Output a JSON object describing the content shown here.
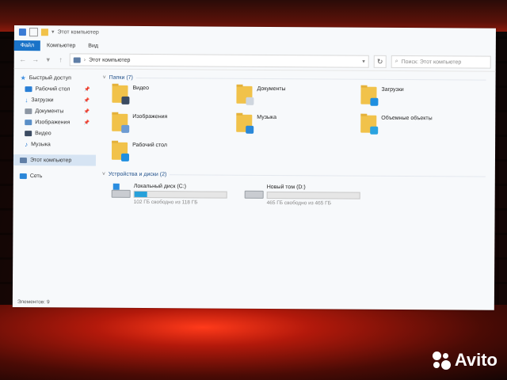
{
  "window": {
    "title": "Этот компьютер",
    "ribbon_tabs": [
      "Файл",
      "Компьютер",
      "Вид"
    ],
    "address": "Этот компьютер",
    "search_placeholder": "Поиск: Этот компьютер"
  },
  "sidebar": {
    "items": [
      {
        "label": "Быстрый доступ",
        "color": "#3c8ee0",
        "head": true
      },
      {
        "label": "Рабочий стол",
        "color": "#2a7fd6",
        "pinned": true
      },
      {
        "label": "Загрузки",
        "color": "#2e86de",
        "pinned": true
      },
      {
        "label": "Документы",
        "color": "#8c96a3",
        "pinned": true
      },
      {
        "label": "Изображения",
        "color": "#5a8fc7",
        "pinned": true
      },
      {
        "label": "Видео",
        "color": "#3b4b62"
      },
      {
        "label": "Музыка",
        "color": "#2d7ad0"
      },
      {
        "label": "Этот компьютер",
        "color": "#5f7ea6",
        "head": true,
        "selected": true
      },
      {
        "label": "Сеть",
        "color": "#2a86d8",
        "head": true
      }
    ]
  },
  "folders_section": "Папки (7)",
  "folders": [
    {
      "label": "Видео",
      "overlay": "#3b4b62"
    },
    {
      "label": "Документы",
      "overlay": "#cfd6de"
    },
    {
      "label": "Загрузки",
      "overlay": "#1f8fe0"
    },
    {
      "label": "Изображения",
      "overlay": "#6c9bd2"
    },
    {
      "label": "Музыка",
      "overlay": "#2a88d8"
    },
    {
      "label": "Объемные объекты",
      "overlay": "#2aa3e0"
    },
    {
      "label": "Рабочий стол",
      "overlay": "#1f8fe0"
    }
  ],
  "drives_section": "Устройства и диски (2)",
  "drives": [
    {
      "label": "Локальный диск (C:)",
      "free": "102 ГБ свободно из 118 ГБ",
      "used_fraction": 0.14,
      "system": true
    },
    {
      "label": "Новый том (D:)",
      "free": "465 ГБ свободно из 465 ГБ",
      "used_fraction": 0.0,
      "system": false
    }
  ],
  "status": "Элементов: 9",
  "watermark": "Avito"
}
